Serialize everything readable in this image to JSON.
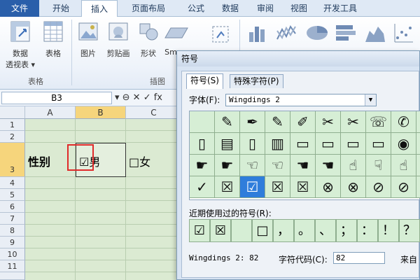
{
  "ribbon": {
    "tabs": [
      "文件",
      "开始",
      "插入",
      "页面布局",
      "公式",
      "数据",
      "审阅",
      "视图",
      "开发工具"
    ],
    "active_tab": "插入",
    "buttons": {
      "pivot_table": "数据\n透视表",
      "pivot_table_line1": "数据",
      "pivot_table_line2": "透视表 ▾",
      "table": "表格",
      "picture": "图片",
      "clipart": "剪贴画",
      "shapes": "形状",
      "smartart": "Sm"
    },
    "groups": {
      "tables": "表格",
      "illustrations": "插图"
    }
  },
  "formula_bar": {
    "name_box": "B3",
    "icons": "▾ ⊖ ✕ ✓ fx"
  },
  "sheet": {
    "columns": [
      "A",
      "B",
      "C"
    ],
    "selected_column": "B",
    "rows": [
      "1",
      "2",
      "3",
      "4",
      "5",
      "6",
      "7",
      "8",
      "9",
      "10",
      "11"
    ],
    "selected_row": "3",
    "cells": {
      "a3": "性别",
      "b3": "☑男",
      "c3": "□女"
    }
  },
  "dialog": {
    "title": "符号",
    "tabs": [
      "符号(S)",
      "特殊字符(P)"
    ],
    "font_label": "字体(F):",
    "font_value": "Wingdings 2",
    "symbols": [
      [
        "",
        "✎",
        "✒",
        "✎",
        "✐",
        "✂",
        "✂",
        "☏",
        "✆",
        "▯",
        "▯"
      ],
      [
        "▯",
        "▤",
        "▯",
        "▥",
        "▭",
        "▭",
        "▭",
        "▭",
        "◉",
        "◙",
        "↩"
      ],
      [
        "☛",
        "☛",
        "☜",
        "☜",
        "☚",
        "☚",
        "☝",
        "☟",
        "☝",
        "☟",
        "☝"
      ],
      [
        "✓",
        "☒",
        "☑",
        "☒",
        "☒",
        "⊗",
        "⊗",
        "⊘",
        "⊘",
        "er",
        "&"
      ]
    ],
    "selected_symbol": "☑",
    "recent_label": "近期使用过的符号(R):",
    "recent": [
      "☑",
      "☒",
      "",
      "□",
      "，",
      "。",
      "、",
      "；",
      "：",
      "！",
      "？"
    ],
    "status_font": "Wingdings 2: 82",
    "code_label": "字符代码(C):",
    "code_value": "82",
    "from_label": "来自"
  },
  "colors": {
    "accent": "#2a5faa",
    "sheet_green": "#dbead2",
    "symbol_bg": "#d6eed5",
    "selected_symbol": "#2f7ddb",
    "highlight_red": "#e02a2a",
    "header_selected": "#f6d57c"
  }
}
